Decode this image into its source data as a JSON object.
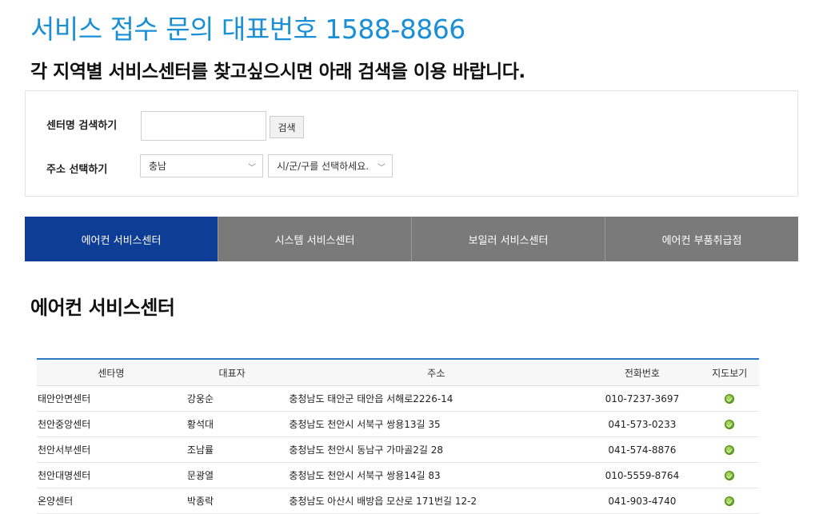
{
  "header": {
    "headline": "서비스 접수 문의 대표번호 1588-8866",
    "subhead": "각 지역별 서비스센터를 찾고싶으시면 아래 검색을 이용 바랍니다."
  },
  "search": {
    "name_label": "센터명 검색하기",
    "name_value": "",
    "search_button": "검색",
    "address_label": "주소 선택하기",
    "province_selected": "충남",
    "city_selected": "시/군/구를 선택하세요."
  },
  "tabs": [
    {
      "label": "에어컨 서비스센터",
      "active": true
    },
    {
      "label": "시스템 서비스센터",
      "active": false
    },
    {
      "label": "보일러 서비스센터",
      "active": false
    },
    {
      "label": "에어컨 부품취급점",
      "active": false
    }
  ],
  "section_title": "에어컨 서비스센터",
  "table": {
    "columns": [
      "센타명",
      "대표자",
      "주소",
      "전화번호",
      "지도보기"
    ],
    "rows": [
      {
        "name": "태안안면센터",
        "rep": "강웅순",
        "address": "충청남도 태안군 태안읍 서해로2226-14",
        "phone": "010-7237-3697"
      },
      {
        "name": "천안중앙센터",
        "rep": "황석대",
        "address": "충청남도 천안시 서북구 쌍용13길 35",
        "phone": "041-573-0233"
      },
      {
        "name": "천안서부센터",
        "rep": "조남률",
        "address": "충청남도 천안시 동남구 가마골2길 28",
        "phone": "041-574-8876"
      },
      {
        "name": "천안대명센터",
        "rep": "문광열",
        "address": "충청남도 천안시 서북구 쌍용14길 83",
        "phone": "010-5559-8764"
      },
      {
        "name": "온양센터",
        "rep": "박종락",
        "address": "충청남도 아산시 배방읍 모산로 171번길 12-2",
        "phone": "041-903-4740"
      }
    ],
    "map_icon": "map-pin-icon"
  },
  "colors": {
    "headline": "#1a8fd6",
    "active_tab": "#0d3d94",
    "inactive_tab": "#7a7a7a",
    "table_top_border": "#2a7bc4"
  }
}
